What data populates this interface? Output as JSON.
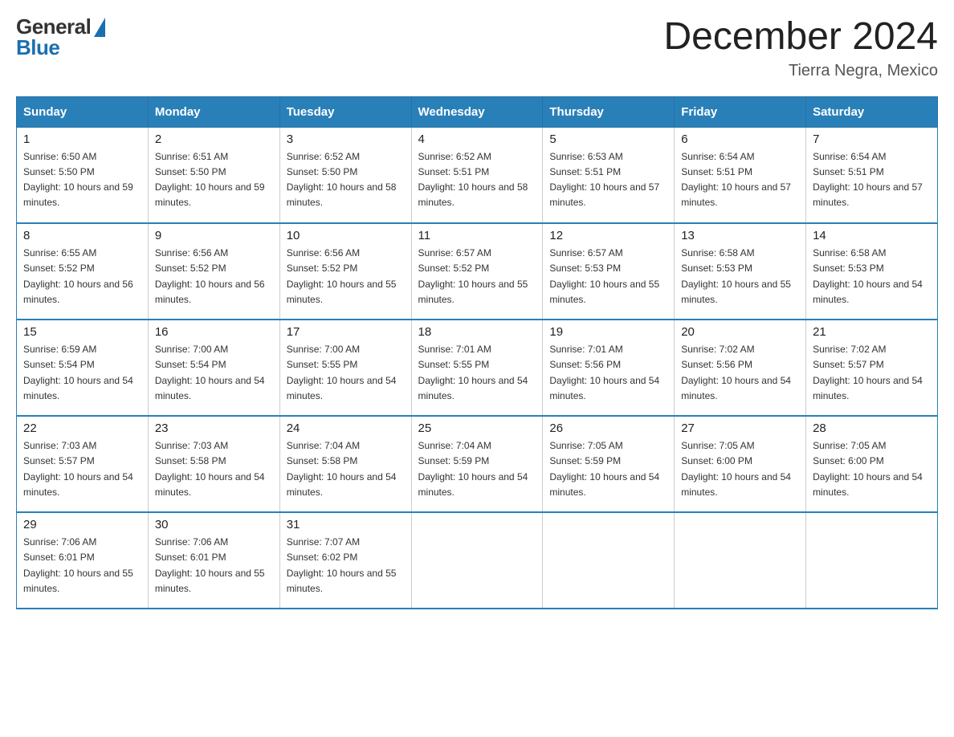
{
  "header": {
    "logo_general": "General",
    "logo_blue": "Blue",
    "month_title": "December 2024",
    "location": "Tierra Negra, Mexico"
  },
  "days_of_week": [
    "Sunday",
    "Monday",
    "Tuesday",
    "Wednesday",
    "Thursday",
    "Friday",
    "Saturday"
  ],
  "weeks": [
    [
      {
        "day": "1",
        "sunrise": "6:50 AM",
        "sunset": "5:50 PM",
        "daylight": "10 hours and 59 minutes."
      },
      {
        "day": "2",
        "sunrise": "6:51 AM",
        "sunset": "5:50 PM",
        "daylight": "10 hours and 59 minutes."
      },
      {
        "day": "3",
        "sunrise": "6:52 AM",
        "sunset": "5:50 PM",
        "daylight": "10 hours and 58 minutes."
      },
      {
        "day": "4",
        "sunrise": "6:52 AM",
        "sunset": "5:51 PM",
        "daylight": "10 hours and 58 minutes."
      },
      {
        "day": "5",
        "sunrise": "6:53 AM",
        "sunset": "5:51 PM",
        "daylight": "10 hours and 57 minutes."
      },
      {
        "day": "6",
        "sunrise": "6:54 AM",
        "sunset": "5:51 PM",
        "daylight": "10 hours and 57 minutes."
      },
      {
        "day": "7",
        "sunrise": "6:54 AM",
        "sunset": "5:51 PM",
        "daylight": "10 hours and 57 minutes."
      }
    ],
    [
      {
        "day": "8",
        "sunrise": "6:55 AM",
        "sunset": "5:52 PM",
        "daylight": "10 hours and 56 minutes."
      },
      {
        "day": "9",
        "sunrise": "6:56 AM",
        "sunset": "5:52 PM",
        "daylight": "10 hours and 56 minutes."
      },
      {
        "day": "10",
        "sunrise": "6:56 AM",
        "sunset": "5:52 PM",
        "daylight": "10 hours and 55 minutes."
      },
      {
        "day": "11",
        "sunrise": "6:57 AM",
        "sunset": "5:52 PM",
        "daylight": "10 hours and 55 minutes."
      },
      {
        "day": "12",
        "sunrise": "6:57 AM",
        "sunset": "5:53 PM",
        "daylight": "10 hours and 55 minutes."
      },
      {
        "day": "13",
        "sunrise": "6:58 AM",
        "sunset": "5:53 PM",
        "daylight": "10 hours and 55 minutes."
      },
      {
        "day": "14",
        "sunrise": "6:58 AM",
        "sunset": "5:53 PM",
        "daylight": "10 hours and 54 minutes."
      }
    ],
    [
      {
        "day": "15",
        "sunrise": "6:59 AM",
        "sunset": "5:54 PM",
        "daylight": "10 hours and 54 minutes."
      },
      {
        "day": "16",
        "sunrise": "7:00 AM",
        "sunset": "5:54 PM",
        "daylight": "10 hours and 54 minutes."
      },
      {
        "day": "17",
        "sunrise": "7:00 AM",
        "sunset": "5:55 PM",
        "daylight": "10 hours and 54 minutes."
      },
      {
        "day": "18",
        "sunrise": "7:01 AM",
        "sunset": "5:55 PM",
        "daylight": "10 hours and 54 minutes."
      },
      {
        "day": "19",
        "sunrise": "7:01 AM",
        "sunset": "5:56 PM",
        "daylight": "10 hours and 54 minutes."
      },
      {
        "day": "20",
        "sunrise": "7:02 AM",
        "sunset": "5:56 PM",
        "daylight": "10 hours and 54 minutes."
      },
      {
        "day": "21",
        "sunrise": "7:02 AM",
        "sunset": "5:57 PM",
        "daylight": "10 hours and 54 minutes."
      }
    ],
    [
      {
        "day": "22",
        "sunrise": "7:03 AM",
        "sunset": "5:57 PM",
        "daylight": "10 hours and 54 minutes."
      },
      {
        "day": "23",
        "sunrise": "7:03 AM",
        "sunset": "5:58 PM",
        "daylight": "10 hours and 54 minutes."
      },
      {
        "day": "24",
        "sunrise": "7:04 AM",
        "sunset": "5:58 PM",
        "daylight": "10 hours and 54 minutes."
      },
      {
        "day": "25",
        "sunrise": "7:04 AM",
        "sunset": "5:59 PM",
        "daylight": "10 hours and 54 minutes."
      },
      {
        "day": "26",
        "sunrise": "7:05 AM",
        "sunset": "5:59 PM",
        "daylight": "10 hours and 54 minutes."
      },
      {
        "day": "27",
        "sunrise": "7:05 AM",
        "sunset": "6:00 PM",
        "daylight": "10 hours and 54 minutes."
      },
      {
        "day": "28",
        "sunrise": "7:05 AM",
        "sunset": "6:00 PM",
        "daylight": "10 hours and 54 minutes."
      }
    ],
    [
      {
        "day": "29",
        "sunrise": "7:06 AM",
        "sunset": "6:01 PM",
        "daylight": "10 hours and 55 minutes."
      },
      {
        "day": "30",
        "sunrise": "7:06 AM",
        "sunset": "6:01 PM",
        "daylight": "10 hours and 55 minutes."
      },
      {
        "day": "31",
        "sunrise": "7:07 AM",
        "sunset": "6:02 PM",
        "daylight": "10 hours and 55 minutes."
      },
      null,
      null,
      null,
      null
    ]
  ]
}
